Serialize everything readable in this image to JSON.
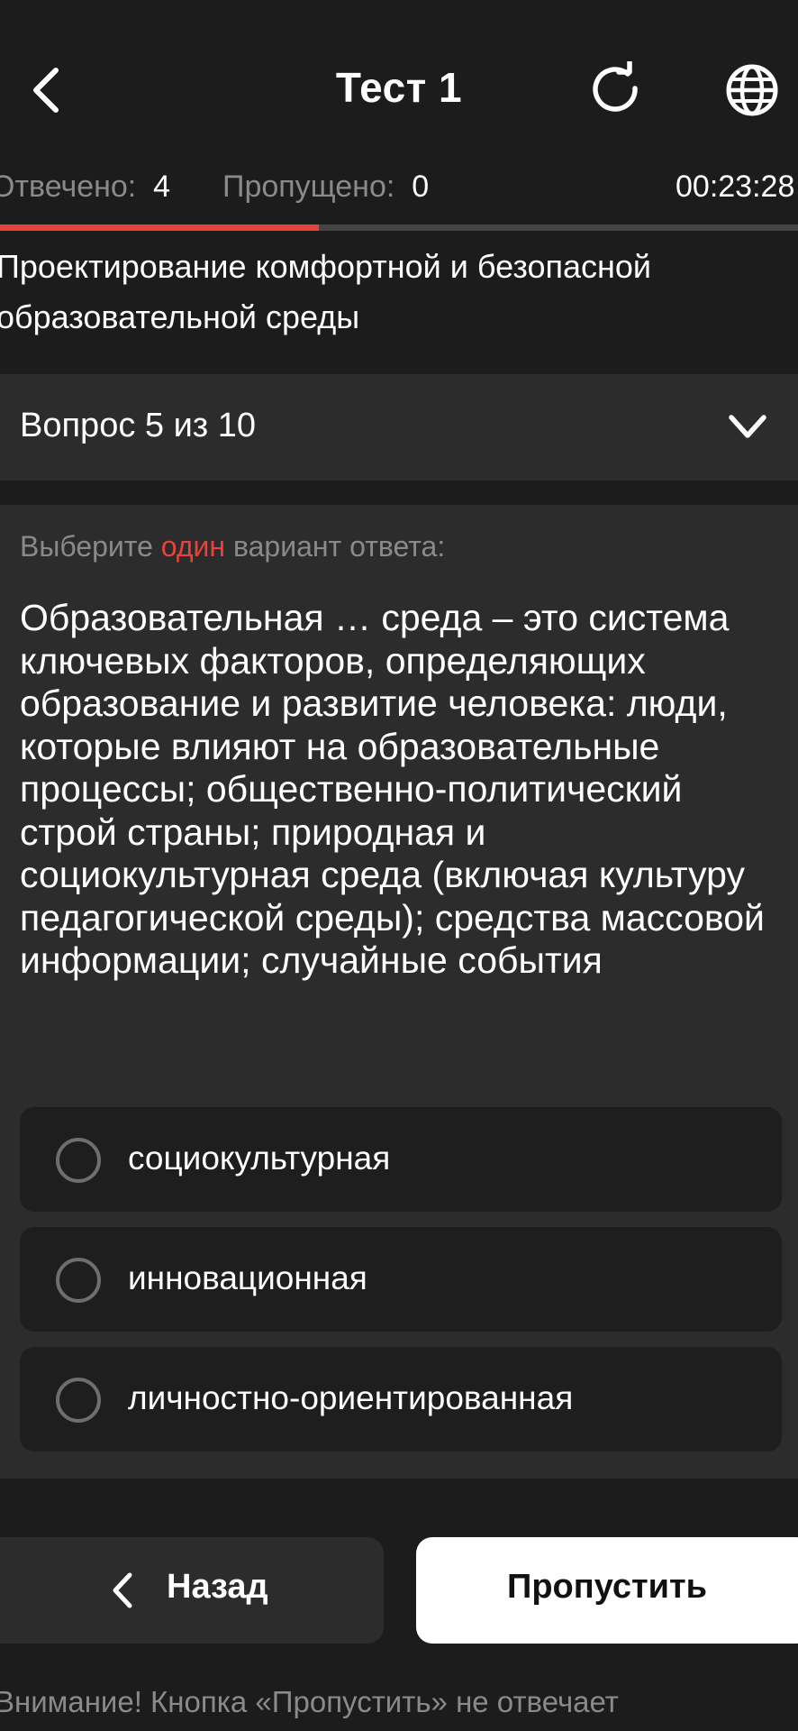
{
  "header": {
    "title": "Тест 1",
    "icons": {
      "back": "chevron-left-icon",
      "refresh": "refresh-icon",
      "language": "globe-icon"
    }
  },
  "stats": {
    "answered_label": "Отвечено:",
    "answered_value": "4",
    "skipped_label": "Пропущено:",
    "skipped_value": "0",
    "timer": "00:23:28"
  },
  "progress": {
    "fraction": 0.4
  },
  "topic": "Проектирование комфортной и безопасной образовательной среды",
  "question_selector": {
    "label": "Вопрос 5 из 10",
    "icon": "chevron-down-icon"
  },
  "question": {
    "instruction_prefix": "Выберите",
    "instruction_accent": "один",
    "instruction_suffix": "вариант ответа:",
    "text": "Образовательная … среда – это система ключевых факторов, определяющих образование и развитие человека: люди, которые влияют на образовательные процессы; общественно-политический строй страны; природная и социокультурная среда (включая культуру педагогической среды); средства массовой информации; случайные события",
    "options": [
      {
        "label": "социокультурная",
        "selected": false
      },
      {
        "label": "инновационная",
        "selected": false
      },
      {
        "label": "личностно-ориентированная",
        "selected": false
      }
    ]
  },
  "navigation": {
    "back_label": "Назад",
    "skip_label": "Пропустить"
  },
  "warning": "Внимание! Кнопка «Пропустить» не отвечает",
  "colors": {
    "background": "#1c1c1c",
    "card": "#2c2c2c",
    "option_bg": "#1e1e1e",
    "accent": "#e8423b",
    "muted_text": "#8a8a8a",
    "progress_track": "#444444"
  }
}
